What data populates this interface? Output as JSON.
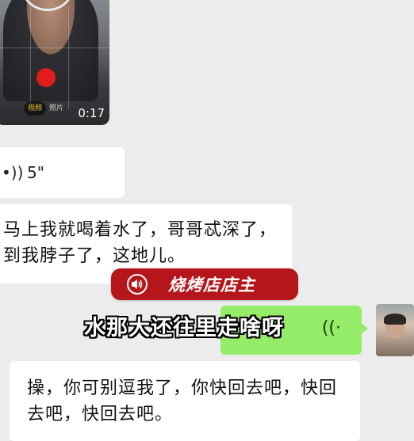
{
  "video": {
    "duration": "0:17",
    "pill_label": "视频",
    "pill_label_2": "照片"
  },
  "voice_message": {
    "wave_icon": "voice-wave-icon",
    "duration": "5\""
  },
  "messages": {
    "incoming_1": "马上我就喝着水了，哥哥忒深了，到我脖子了，这地儿。",
    "incoming_2": "操，你可别逗我了，你快回去吧，快回去吧，快回去吧。"
  },
  "banner": {
    "icon": "speaker-icon",
    "name": "烧烤店店主"
  },
  "subtitle": "水那大还往里走啥呀",
  "colors": {
    "background": "#ececec",
    "bubble_incoming": "#ffffff",
    "bubble_outgoing": "#95ec69",
    "banner": "#b5161b",
    "record_dot": "#e11c1c"
  }
}
